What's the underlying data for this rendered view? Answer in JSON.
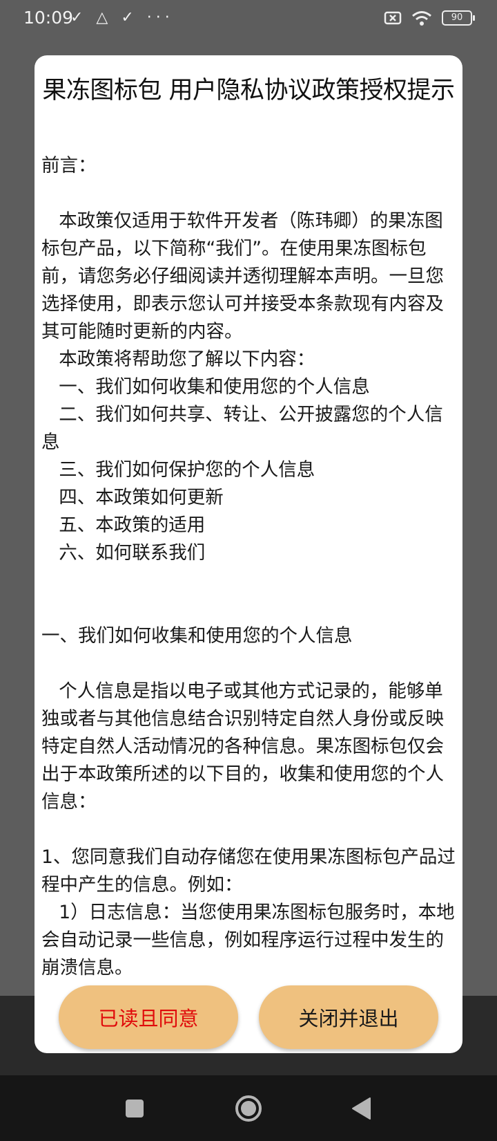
{
  "status_bar": {
    "time": "10:09",
    "left_icons": "✓ △ ✓ ···",
    "battery": "90"
  },
  "dialog": {
    "title": "果冻图标包 用户隐私协议政策授权提示",
    "paragraphs": {
      "p0": "前言：",
      "p1": "   本政策仅适用于软件开发者（陈玮卿）的果冻图标包产品，以下简称“我们”。在使用果冻图标包前，请您务必仔细阅读并透彻理解本声明。一旦您选择使用，即表示您认可并接受本条款现有内容及其可能随时更新的内容。",
      "p2": "   本政策将帮助您了解以下内容：",
      "p3": "   一、我们如何收集和使用您的个人信息",
      "p4": "   二、我们如何共享、转让、公开披露您的个人信息",
      "p5": "   三、我们如何保护您的个人信息",
      "p6": "   四、本政策如何更新",
      "p7": "   五、本政策的适用",
      "p8": "   六、如何联系我们",
      "p9": "一、我们如何收集和使用您的个人信息",
      "p10": "   个人信息是指以电子或其他方式记录的，能够单独或者与其他信息结合识别特定自然人身份或反映特定自然人活动情况的各种信息。果冻图标包仅会出于本政策所述的以下目的，收集和使用您的个人信息：",
      "p11": "1、您同意我们自动存储您在使用果冻图标包产品过程中产生的信息。例如：",
      "p12": "   1）日志信息：当您使用果冻图标包服务时，本地会自动记录一些信息，例如程序运行过程中发生的崩溃信息。"
    },
    "agree_label": "已读且同意",
    "exit_label": "关闭并退出"
  },
  "colors": {
    "button_bg": "#efc17f",
    "agree_text": "#e00b0b"
  }
}
